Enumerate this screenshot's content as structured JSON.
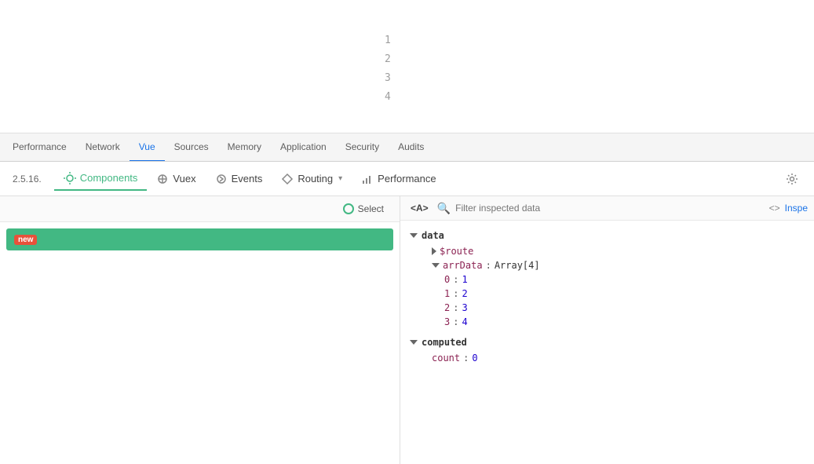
{
  "code_area": {
    "line_numbers": [
      "1",
      "2",
      "3",
      "4"
    ]
  },
  "devtools_tabs": {
    "items": [
      {
        "label": "Performance",
        "active": false
      },
      {
        "label": "Network",
        "active": false
      },
      {
        "label": "Vue",
        "active": true
      },
      {
        "label": "Sources",
        "active": false
      },
      {
        "label": "Memory",
        "active": false
      },
      {
        "label": "Application",
        "active": false
      },
      {
        "label": "Security",
        "active": false
      },
      {
        "label": "Audits",
        "active": false
      }
    ]
  },
  "vue_toolbar": {
    "version": "2.5.16.",
    "components_label": "Components",
    "vuex_label": "Vuex",
    "events_label": "Events",
    "routing_label": "Routing",
    "performance_label": "Performance"
  },
  "left_panel": {
    "select_label": "Select",
    "component_label": "new"
  },
  "right_panel": {
    "tag_label": "<A>",
    "filter_placeholder": "Filter inspected data",
    "inspect_label": "Inspe",
    "data_section": {
      "label": "data",
      "route_key": "$route",
      "arr_key": "arrData",
      "arr_type": "Array[4]",
      "items": [
        {
          "index": "0",
          "value": "1"
        },
        {
          "index": "1",
          "value": "2"
        },
        {
          "index": "2",
          "value": "3"
        },
        {
          "index": "3",
          "value": "4"
        }
      ]
    },
    "computed_section": {
      "label": "computed",
      "count_key": "count",
      "count_value": "0"
    }
  }
}
